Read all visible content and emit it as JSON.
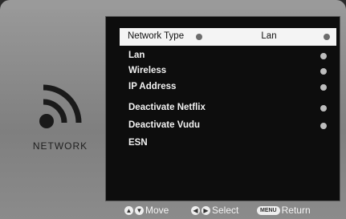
{
  "sidebar": {
    "label": "NETWORK"
  },
  "menu": {
    "selected": {
      "label": "Network Type",
      "value": "Lan"
    },
    "items": [
      {
        "label": "Lan",
        "has_arrow": true
      },
      {
        "label": "Wireless",
        "has_arrow": true
      },
      {
        "label": "IP Address",
        "has_arrow": true
      },
      {
        "label": "Deactivate Netflix",
        "has_arrow": true
      },
      {
        "label": "Deactivate Vudu",
        "has_arrow": true
      },
      {
        "label": "ESN",
        "has_arrow": false
      }
    ]
  },
  "footer": {
    "move_label": "Move",
    "select_label": "Select",
    "menu_key": "MENU",
    "return_label": "Return"
  },
  "icons": {
    "network": "wifi-broadcast-icon",
    "up": "up-arrow-circle-icon",
    "down": "down-arrow-circle-icon",
    "left": "left-arrow-circle-icon",
    "right": "right-arrow-circle-icon",
    "menu": "menu-key-icon"
  }
}
